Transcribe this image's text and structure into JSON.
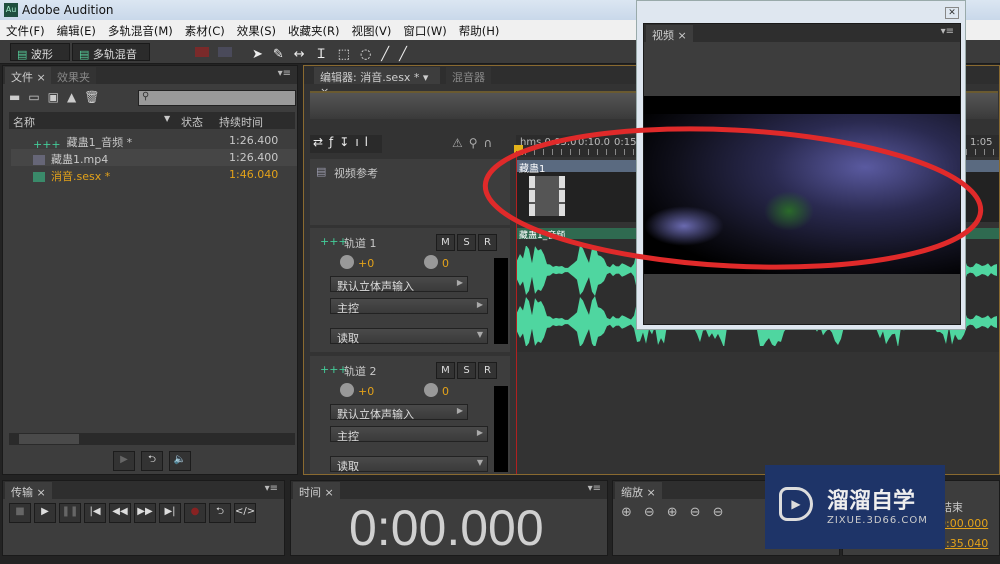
{
  "app": {
    "title": "Adobe Audition",
    "logo": "Au"
  },
  "menu": [
    "文件(F)",
    "编辑(E)",
    "多轨混音(M)",
    "素材(C)",
    "效果(S)",
    "收藏夹(R)",
    "视图(V)",
    "窗口(W)",
    "帮助(H)"
  ],
  "toolbar": {
    "waveform": "波形",
    "multitrack": "多轨混音"
  },
  "files_panel": {
    "tabs": [
      "文件",
      "效果夹"
    ],
    "columns": {
      "name": "名称",
      "status": "状态",
      "duration": "持续时间"
    },
    "items": [
      {
        "name": "藏蛊1_音频 *",
        "duration": "1:26.400",
        "icon": "audio-wave-icon"
      },
      {
        "name": "藏蛊1.mp4",
        "duration": "1:26.400",
        "icon": "film-icon"
      },
      {
        "name": "消音.sesx *",
        "duration": "1:46.040",
        "icon": "multitrack-icon",
        "highlight": true
      }
    ]
  },
  "editor": {
    "tab": "编辑器: 消音.sesx *",
    "mixer_tab": "混音器",
    "ruler": [
      "hms 0:05.0",
      "0:10.0",
      "0:15.",
      "1:05"
    ],
    "video_track": {
      "label": "视频参考",
      "clip": "藏蛊1"
    },
    "tracks": [
      {
        "name": "轨道 1",
        "volume": "+0",
        "pan": "0",
        "input": "默认立体声输入",
        "output": "主控",
        "mode": "读取",
        "clip": "藏蛊1_音频"
      },
      {
        "name": "轨道 2",
        "volume": "+0",
        "pan": "0",
        "input": "默认立体声输入",
        "output": "主控",
        "mode": "读取"
      }
    ],
    "buttons": {
      "mute": "M",
      "solo": "S",
      "record": "R"
    }
  },
  "video_window": {
    "tab": "视频"
  },
  "transport": {
    "tab": "传输"
  },
  "time": {
    "tab": "时间",
    "value": "0:00.000"
  },
  "zoom": {
    "tab": "缩放"
  },
  "selection": {
    "end_label": "结束",
    "start_value": "0:00.000",
    "end_value": "1:35.040"
  },
  "watermark": {
    "title": "溜溜自学",
    "url": "ZIXUE.3D66.COM",
    "color": "#1e3468"
  },
  "annotation_color": "#e02a2a"
}
